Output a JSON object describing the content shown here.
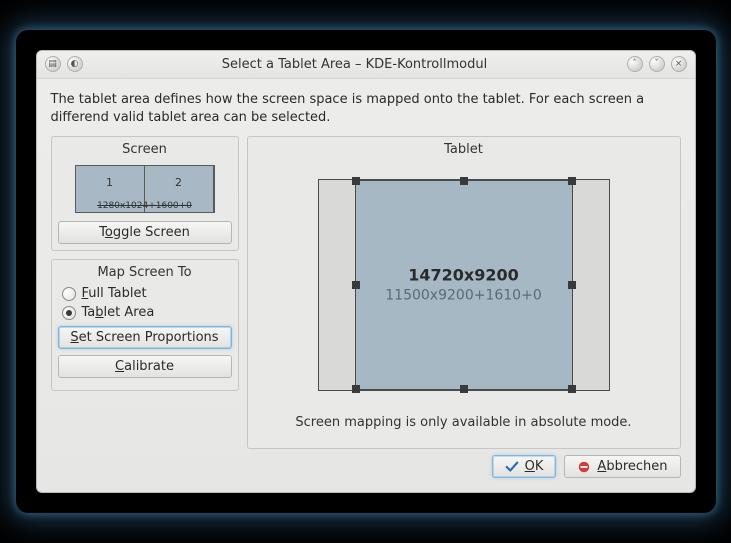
{
  "window": {
    "title": "Select a Tablet Area – KDE-Kontrollmodul"
  },
  "description": "The tablet area defines how the screen space is mapped onto the tablet. For each screen a differend valid tablet area can be selected.",
  "screen_group": {
    "legend": "Screen",
    "screens": [
      {
        "num": "1",
        "width": 70
      },
      {
        "num": "2",
        "width": 70
      }
    ],
    "coords": "1280x1024+1600+0",
    "toggle_label_pre": "T",
    "toggle_label_u": "o",
    "toggle_label_post": "ggle Screen"
  },
  "map_group": {
    "legend": "Map Screen To",
    "full_pre": "",
    "full_u": "F",
    "full_post": "ull Tablet",
    "area_pre": "Ta",
    "area_u": "b",
    "area_post": "let Area",
    "selected": "area",
    "setprop_pre": "",
    "setprop_u": "S",
    "setprop_post": "et Screen Proportions",
    "calib_pre": "",
    "calib_u": "C",
    "calib_post": "alibrate"
  },
  "tablet_group": {
    "legend": "Tablet",
    "resolution": "14720x9200",
    "geometry": "11500x9200+1610+0",
    "hint": "Screen mapping is only available in absolute mode."
  },
  "buttons": {
    "ok_u": "O",
    "ok_post": "K",
    "cancel_u": "A",
    "cancel_post": "bbrechen"
  }
}
